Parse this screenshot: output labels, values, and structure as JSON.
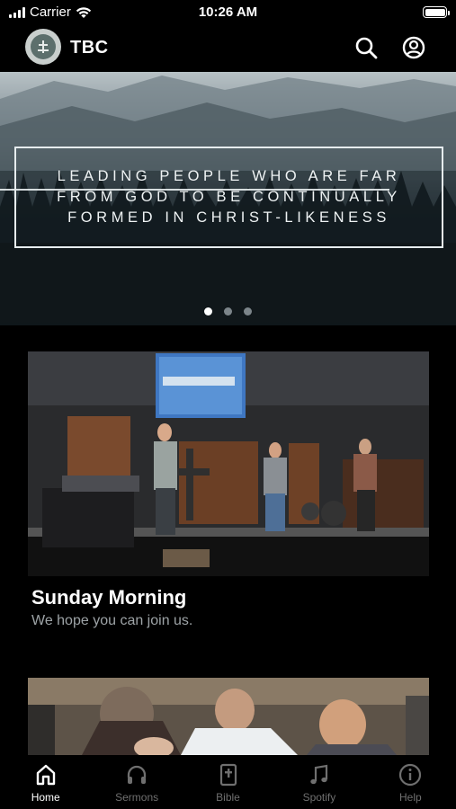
{
  "status_bar": {
    "carrier": "Carrier",
    "time": "10:26 AM",
    "battery_level": 1.0
  },
  "app_bar": {
    "title": "TBC",
    "logo_icon": "church-logo-icon",
    "search_icon": "search-icon",
    "account_icon": "account-circle-icon"
  },
  "hero": {
    "text": "Leading people who are far from God to be continually formed in Christ-likeness",
    "slides": 3,
    "active_slide": 1
  },
  "cards": [
    {
      "title": "Sunday Morning",
      "subtitle": "We hope you can join us."
    },
    {
      "title": "",
      "subtitle": ""
    }
  ],
  "tab_bar": {
    "tabs": [
      {
        "label": "Home",
        "icon": "home-icon",
        "active": true
      },
      {
        "label": "Sermons",
        "icon": "headphones-icon",
        "active": false
      },
      {
        "label": "Bible",
        "icon": "bible-icon",
        "active": false
      },
      {
        "label": "Spotify",
        "icon": "music-note-icon",
        "active": false
      },
      {
        "label": "Help",
        "icon": "info-icon",
        "active": false
      }
    ]
  }
}
